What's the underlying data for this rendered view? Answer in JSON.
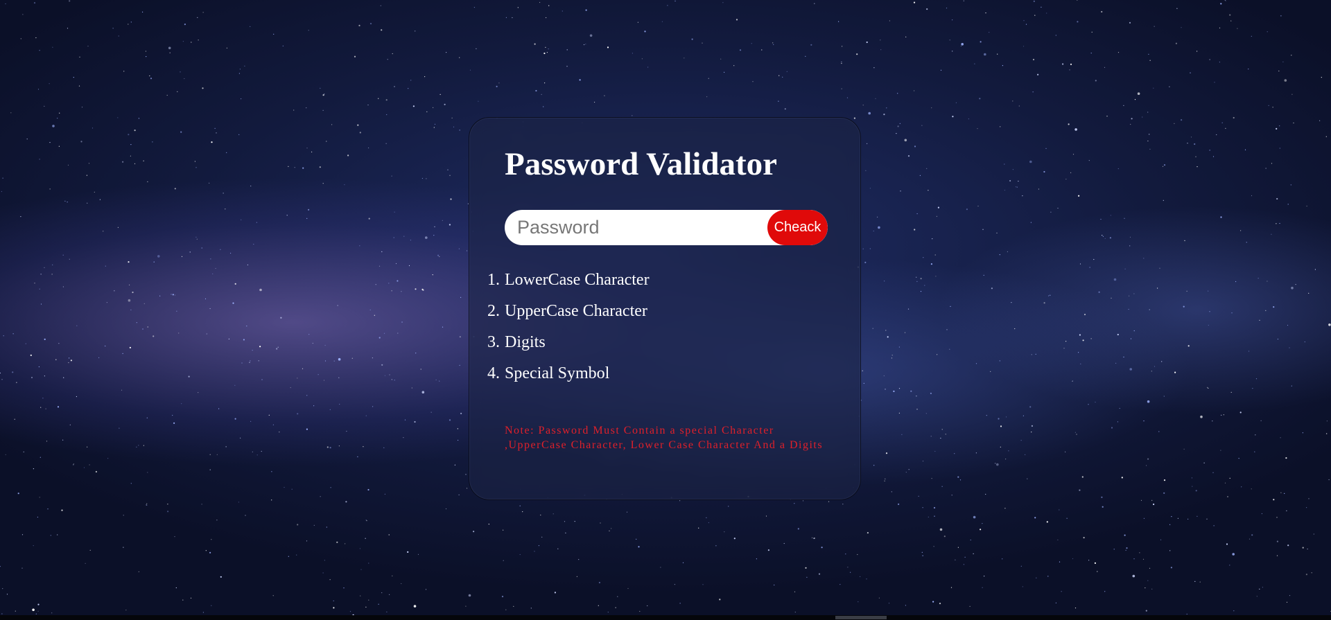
{
  "card": {
    "title": "Password Validator",
    "password_placeholder": "Password",
    "password_value": "",
    "check_button_label": "Cheack",
    "rules": [
      {
        "number": "1.",
        "label": "LowerCase Character"
      },
      {
        "number": "2.",
        "label": "UpperCase Character"
      },
      {
        "number": "3.",
        "label": "Digits"
      },
      {
        "number": "4.",
        "label": "Special Symbol"
      }
    ],
    "note": "Note: Password Must Contain a special Character ,UpperCase Character, Lower Case Character And a Digits"
  },
  "colors": {
    "accent": "#e00a0a",
    "note_text": "#e0202a",
    "text": "#ffffff",
    "card_bg": "rgba(28,36,70,0.62)"
  },
  "background": {
    "description_icon": "starry-night-sky"
  }
}
